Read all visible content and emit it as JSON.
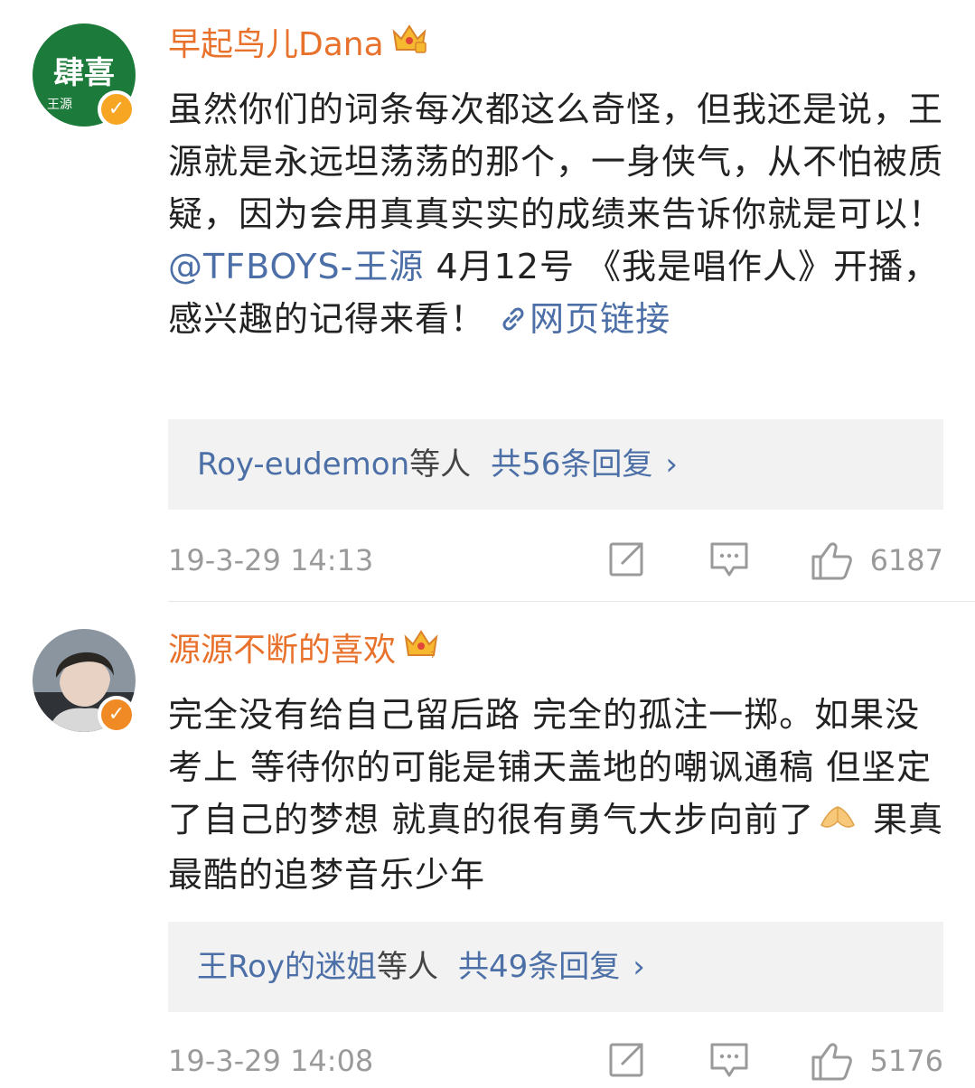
{
  "comments": [
    {
      "username": "早起鸟儿Dana",
      "avatar_text": "肆喜",
      "avatar_subtext": "王源",
      "content_before": "虽然你们的词条每次都这么奇怪，但我还是说，王源就是永远坦荡荡的那个，一身侠气，从不怕被质疑，因为会用真真实实的成绩来告诉你就是可以！",
      "mention": "@TFBOYS-王源",
      "content_after": " 4月12号 《我是唱作人》开播，感兴趣的记得来看！ ",
      "link_label": "网页链接",
      "reply_user": "Roy-eudemon",
      "reply_etc": "等人",
      "reply_count": "共56条回复",
      "reply_chevron": "›",
      "timestamp": "19-3-29 14:13",
      "likes": "6187",
      "colors": {
        "avatar_bg": "#1c7a3a"
      }
    },
    {
      "username": "源源不断的喜欢",
      "content_before": "完全没有给自己留后路 完全的孤注一掷。如果没考上 等待你的可能是铺天盖地的嘲讽通稿 但坚定了自己的梦想 就真的很有勇气大步向前了",
      "content_after": " 果真最酷的追梦音乐少年",
      "reply_user": "王Roy的迷姐",
      "reply_etc": "等人",
      "reply_count": "共49条回复",
      "reply_chevron": "›",
      "timestamp": "19-3-29 14:08",
      "likes": "5176",
      "colors": {
        "avatar_bg": "#8a95a0"
      }
    }
  ],
  "icons": {
    "verified": "verified-badge-icon",
    "crown": "crown-icon",
    "link": "link-icon",
    "share": "share-icon",
    "comment": "comment-icon",
    "like": "thumbs-up-icon",
    "emoji": "praying-hands-emoji-icon"
  },
  "colors": {
    "username": "#e8722c",
    "link": "#4b6fa6",
    "meta": "#9a9a9a",
    "reply_bg": "#f2f2f2"
  }
}
